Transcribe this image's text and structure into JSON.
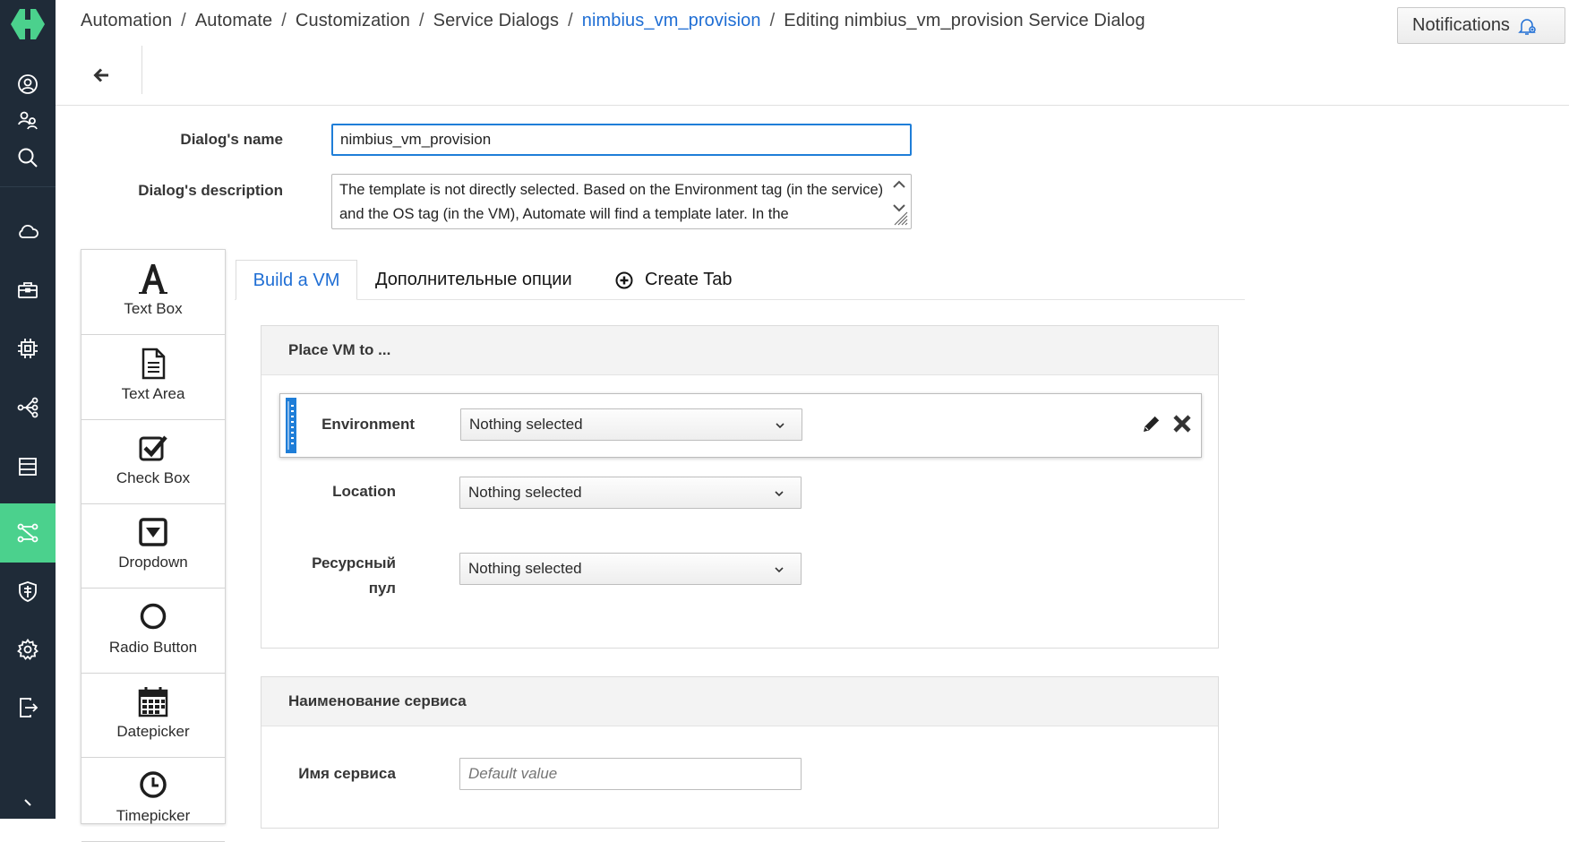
{
  "colors": {
    "nav_bg": "#1f2b38",
    "nav_active": "#4bd18d",
    "link": "#1f6ed4",
    "focus_border": "#1f7ed8"
  },
  "nav": {
    "items": [
      {
        "icon": "user-circle-icon"
      },
      {
        "icon": "users-icon"
      },
      {
        "icon": "search-icon"
      },
      {
        "icon": "cloud-icon"
      },
      {
        "icon": "toolbox-icon"
      },
      {
        "icon": "chip-icon"
      },
      {
        "icon": "network-icon"
      },
      {
        "icon": "storage-icon"
      },
      {
        "icon": "automation-icon",
        "active": true
      },
      {
        "icon": "shield-icon"
      },
      {
        "icon": "gear-icon"
      },
      {
        "icon": "logout-icon"
      }
    ]
  },
  "breadcrumb": {
    "items": [
      "Automation",
      "Automate",
      "Customization",
      "Service Dialogs",
      "nimbius_vm_provision",
      "Editing nimbius_vm_provision Service Dialog"
    ],
    "separator": "/"
  },
  "header": {
    "notifications_label": "Notifications"
  },
  "general": {
    "name_label": "Dialog's name",
    "name_value": "nimbius_vm_provision",
    "description_label": "Dialog's description",
    "description_value": "The template is not directly selected. Based on the Environment tag (in the service) and the OS tag (in the VM), Automate will find a template later. In the"
  },
  "toolbox": {
    "items": [
      {
        "label": "Text Box",
        "icon": "text-box-icon"
      },
      {
        "label": "Text Area",
        "icon": "text-area-icon"
      },
      {
        "label": "Check Box",
        "icon": "check-box-icon"
      },
      {
        "label": "Dropdown",
        "icon": "dropdown-icon"
      },
      {
        "label": "Radio Button",
        "icon": "radio-button-icon"
      },
      {
        "label": "Datepicker",
        "icon": "calendar-icon"
      },
      {
        "label": "Timepicker",
        "icon": "clock-icon"
      }
    ]
  },
  "tabs": {
    "items": [
      "Build a VM",
      "Дополнительные опции"
    ],
    "create_label": "Create Tab",
    "active_index": 0
  },
  "sections": [
    {
      "title": "Place VM to ...",
      "fields": [
        {
          "label": "Environment",
          "value": "Nothing selected"
        },
        {
          "label": "Location",
          "value": "Nothing selected"
        },
        {
          "label_line1": "Ресурсный",
          "label_line2": "пул",
          "value": "Nothing selected"
        }
      ]
    },
    {
      "title": "Наименование сервиса",
      "fields": [
        {
          "label": "Имя сервиса",
          "placeholder": "Default value"
        }
      ]
    }
  ]
}
